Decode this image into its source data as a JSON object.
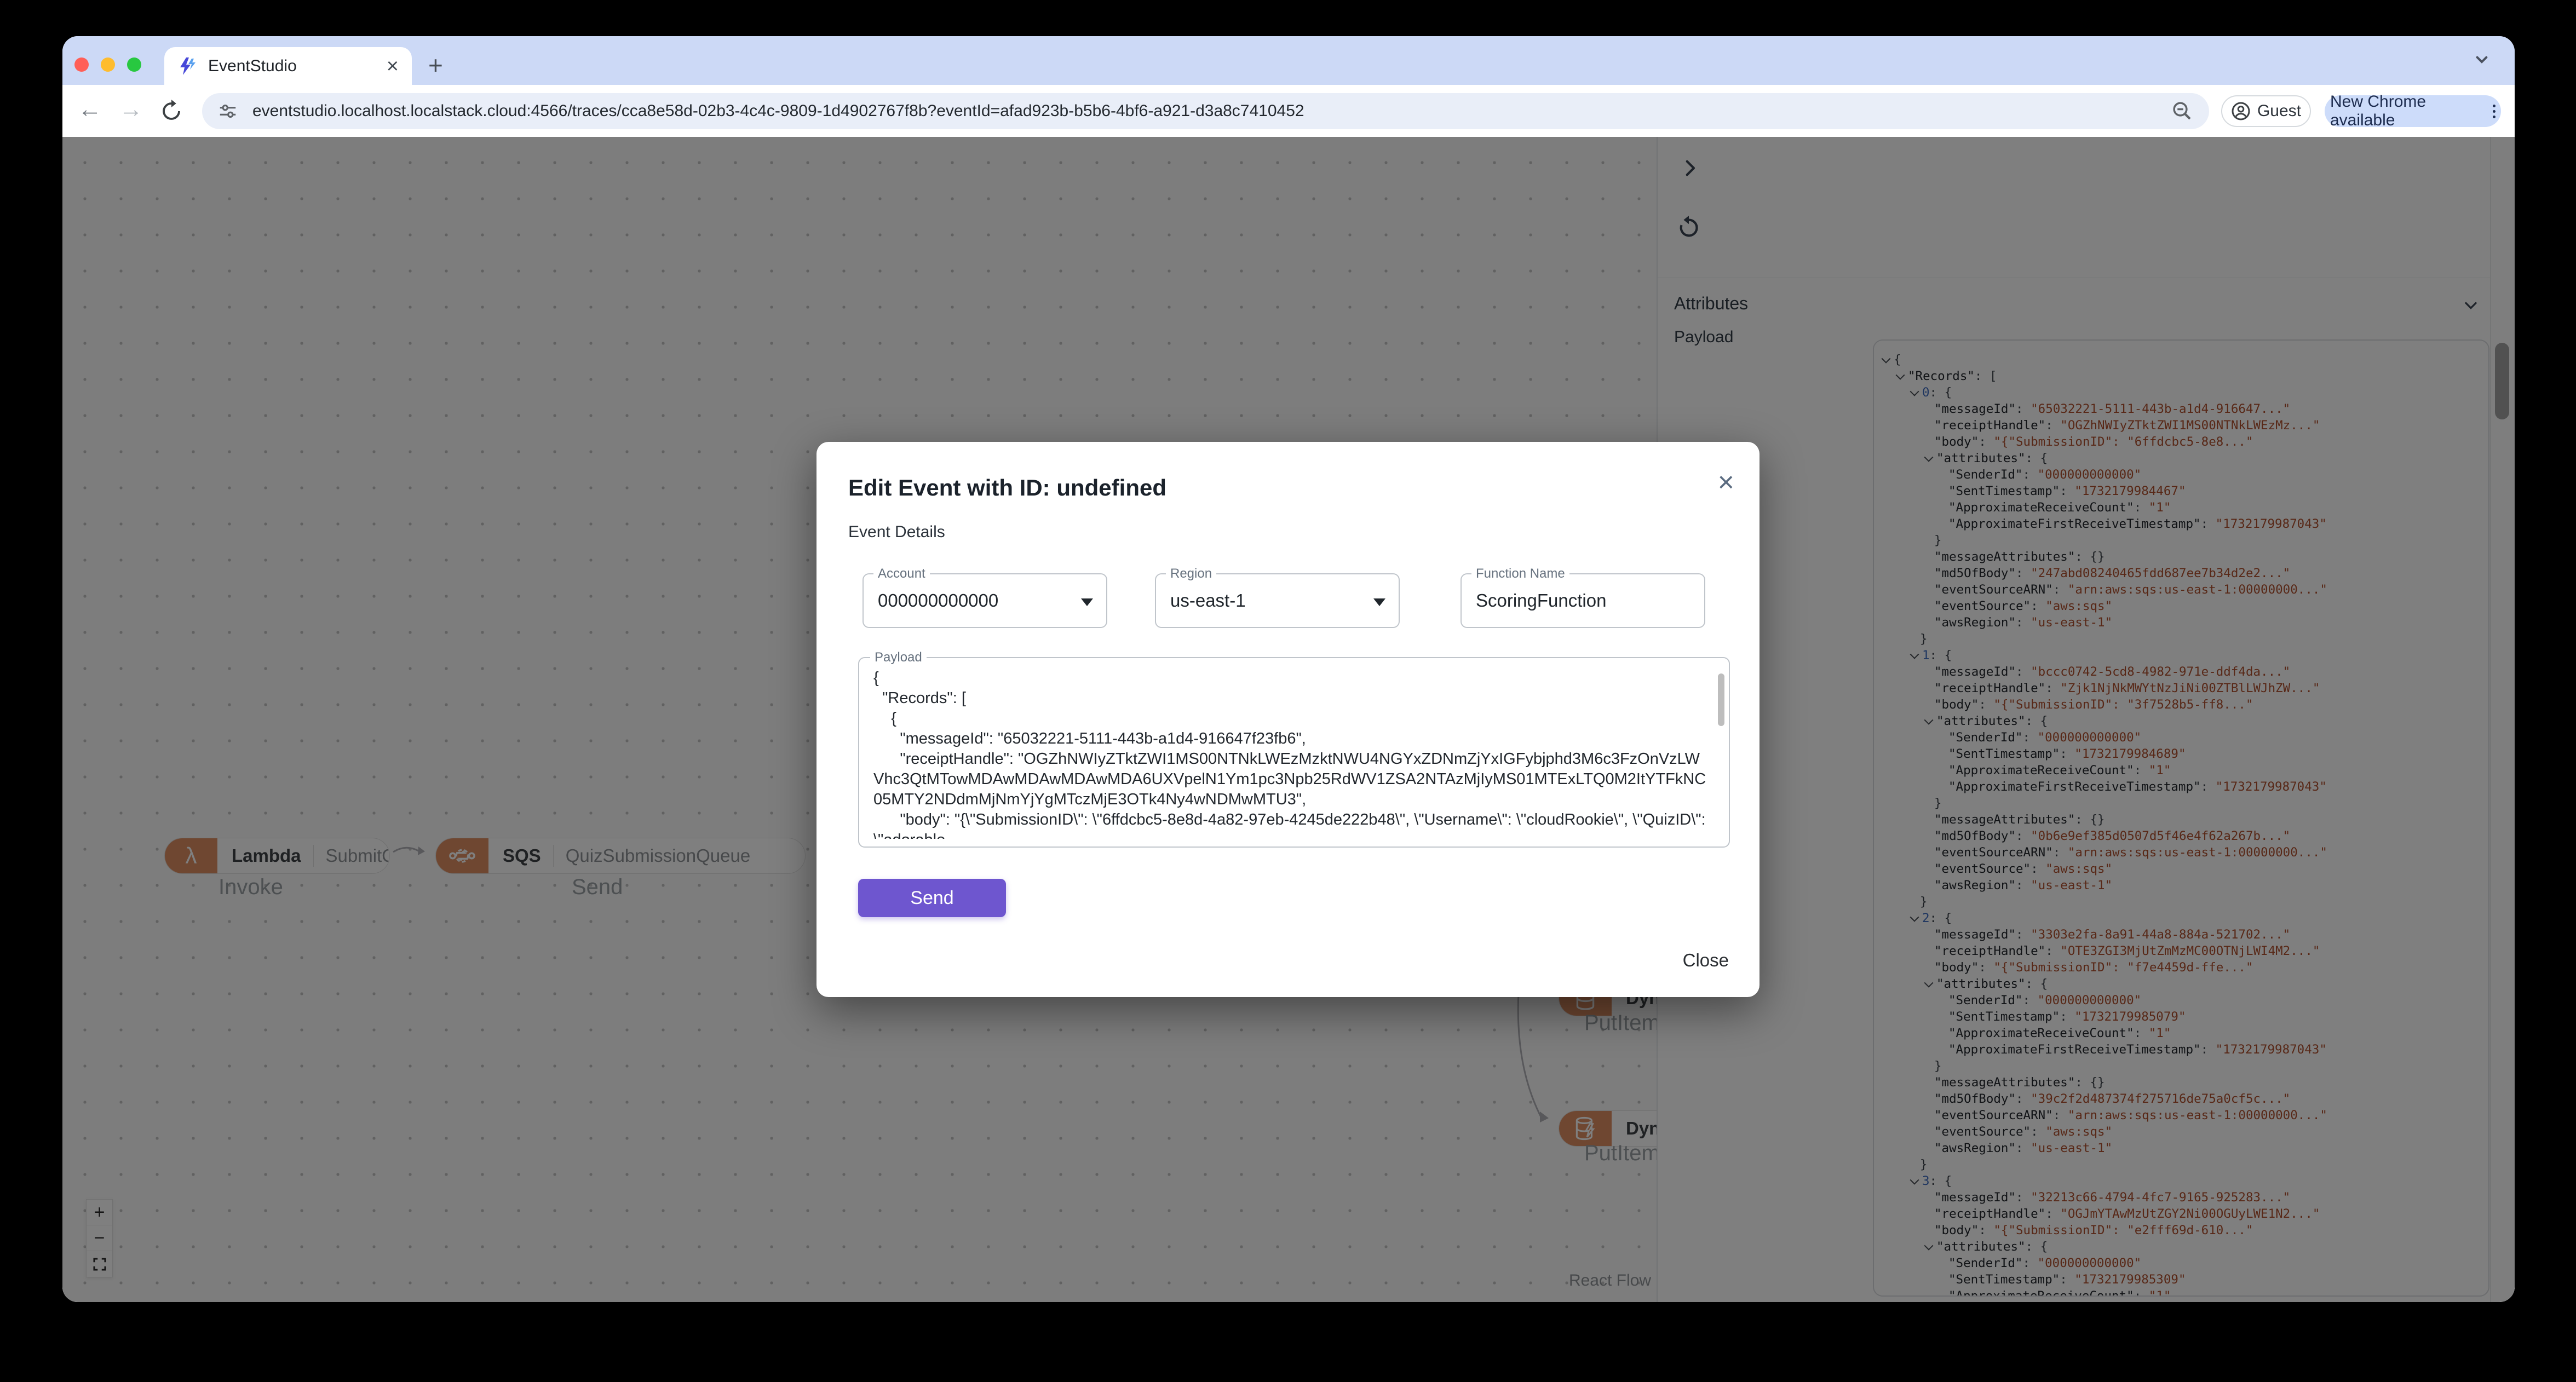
{
  "browser": {
    "tab_title": "EventStudio",
    "url": "eventstudio.localhost.localstack.cloud:4566/traces/cca8e58d-02b3-4c4c-9809-1d4902767f8b?eventId=afad923b-b5b6-4bf6-a921-d3a8c7410452",
    "profile_label": "Guest",
    "update_label": "New Chrome available"
  },
  "icons": {
    "close": "×",
    "plus": "+",
    "minus": "−",
    "back": "←",
    "forward": "→",
    "lambda_glyph": "λ"
  },
  "canvas": {
    "nodes": {
      "lambda": {
        "type": "Lambda",
        "name": "SubmitQuizFunction",
        "edge_label": "Invoke"
      },
      "sqs": {
        "type": "SQS",
        "name": "QuizSubmissionQueue",
        "edge_label": "Send"
      },
      "dynamodb_top": {
        "type": "DynamoDB",
        "edge_label": "PutItem"
      },
      "dynamodb_bottom": {
        "type": "DynamoDB",
        "edge_label": "PutItem"
      }
    },
    "attribution": "React Flow"
  },
  "panel": {
    "attributes_label": "Attributes",
    "payload_label": "Payload",
    "json_lines": [
      {
        "d": 0,
        "c": 1,
        "v": "{",
        "vt": "p"
      },
      {
        "d": 1,
        "c": 1,
        "k": "\"Records\"",
        "v": "[",
        "vt": "p"
      },
      {
        "d": 2,
        "c": 1,
        "k": "0",
        "ki": "i",
        "v": "{",
        "vt": "p"
      },
      {
        "d": 3,
        "k": "\"messageId\"",
        "v": "\"65032221-5111-443b-a1d4-916647...\"",
        "vt": "s"
      },
      {
        "d": 3,
        "k": "\"receiptHandle\"",
        "v": "\"OGZhNWIyZTktZWI1MS00NTNkLWEzMz...\"",
        "vt": "s"
      },
      {
        "d": 3,
        "k": "\"body\"",
        "v": "\"{\"SubmissionID\": \"6ffdcbc5-8e8...\"",
        "vt": "s"
      },
      {
        "d": 3,
        "c": 1,
        "k": "\"attributes\"",
        "v": "{",
        "vt": "p"
      },
      {
        "d": 4,
        "k": "\"SenderId\"",
        "v": "\"000000000000\"",
        "vt": "s"
      },
      {
        "d": 4,
        "k": "\"SentTimestamp\"",
        "v": "\"1732179984467\"",
        "vt": "s"
      },
      {
        "d": 4,
        "k": "\"ApproximateReceiveCount\"",
        "v": "\"1\"",
        "vt": "s"
      },
      {
        "d": 4,
        "k": "\"ApproximateFirstReceiveTimestamp\"",
        "v": "\"1732179987043\"",
        "vt": "s"
      },
      {
        "d": 3,
        "v": "}",
        "vt": "p"
      },
      {
        "d": 3,
        "k": "\"messageAttributes\"",
        "v": "{}",
        "vt": "p"
      },
      {
        "d": 3,
        "k": "\"md5OfBody\"",
        "v": "\"247abd08240465fdd687ee7b34d2e2...\"",
        "vt": "s"
      },
      {
        "d": 3,
        "k": "\"eventSourceARN\"",
        "v": "\"arn:aws:sqs:us-east-1:00000000...\"",
        "vt": "s"
      },
      {
        "d": 3,
        "k": "\"eventSource\"",
        "v": "\"aws:sqs\"",
        "vt": "s"
      },
      {
        "d": 3,
        "k": "\"awsRegion\"",
        "v": "\"us-east-1\"",
        "vt": "s"
      },
      {
        "d": 2,
        "v": "}",
        "vt": "p"
      },
      {
        "d": 2,
        "c": 1,
        "k": "1",
        "ki": "i",
        "v": "{",
        "vt": "p"
      },
      {
        "d": 3,
        "k": "\"messageId\"",
        "v": "\"bccc0742-5cd8-4982-971e-ddf4da...\"",
        "vt": "s"
      },
      {
        "d": 3,
        "k": "\"receiptHandle\"",
        "v": "\"Zjk1NjNkMWYtNzJiNi00ZTBlLWJhZW...\"",
        "vt": "s"
      },
      {
        "d": 3,
        "k": "\"body\"",
        "v": "\"{\"SubmissionID\": \"3f7528b5-ff8...\"",
        "vt": "s"
      },
      {
        "d": 3,
        "c": 1,
        "k": "\"attributes\"",
        "v": "{",
        "vt": "p"
      },
      {
        "d": 4,
        "k": "\"SenderId\"",
        "v": "\"000000000000\"",
        "vt": "s"
      },
      {
        "d": 4,
        "k": "\"SentTimestamp\"",
        "v": "\"1732179984689\"",
        "vt": "s"
      },
      {
        "d": 4,
        "k": "\"ApproximateReceiveCount\"",
        "v": "\"1\"",
        "vt": "s"
      },
      {
        "d": 4,
        "k": "\"ApproximateFirstReceiveTimestamp\"",
        "v": "\"1732179987043\"",
        "vt": "s"
      },
      {
        "d": 3,
        "v": "}",
        "vt": "p"
      },
      {
        "d": 3,
        "k": "\"messageAttributes\"",
        "v": "{}",
        "vt": "p"
      },
      {
        "d": 3,
        "k": "\"md5OfBody\"",
        "v": "\"0b6e9ef385d0507d5f46e4f62a267b...\"",
        "vt": "s"
      },
      {
        "d": 3,
        "k": "\"eventSourceARN\"",
        "v": "\"arn:aws:sqs:us-east-1:00000000...\"",
        "vt": "s"
      },
      {
        "d": 3,
        "k": "\"eventSource\"",
        "v": "\"aws:sqs\"",
        "vt": "s"
      },
      {
        "d": 3,
        "k": "\"awsRegion\"",
        "v": "\"us-east-1\"",
        "vt": "s"
      },
      {
        "d": 2,
        "v": "}",
        "vt": "p"
      },
      {
        "d": 2,
        "c": 1,
        "k": "2",
        "ki": "i",
        "v": "{",
        "vt": "p"
      },
      {
        "d": 3,
        "k": "\"messageId\"",
        "v": "\"3303e2fa-8a91-44a8-884a-521702...\"",
        "vt": "s"
      },
      {
        "d": 3,
        "k": "\"receiptHandle\"",
        "v": "\"OTE3ZGI3MjUtZmMzMC00OTNjLWI4M2...\"",
        "vt": "s"
      },
      {
        "d": 3,
        "k": "\"body\"",
        "v": "\"{\"SubmissionID\": \"f7e4459d-ffe...\"",
        "vt": "s"
      },
      {
        "d": 3,
        "c": 1,
        "k": "\"attributes\"",
        "v": "{",
        "vt": "p"
      },
      {
        "d": 4,
        "k": "\"SenderId\"",
        "v": "\"000000000000\"",
        "vt": "s"
      },
      {
        "d": 4,
        "k": "\"SentTimestamp\"",
        "v": "\"1732179985079\"",
        "vt": "s"
      },
      {
        "d": 4,
        "k": "\"ApproximateReceiveCount\"",
        "v": "\"1\"",
        "vt": "s"
      },
      {
        "d": 4,
        "k": "\"ApproximateFirstReceiveTimestamp\"",
        "v": "\"1732179987043\"",
        "vt": "s"
      },
      {
        "d": 3,
        "v": "}",
        "vt": "p"
      },
      {
        "d": 3,
        "k": "\"messageAttributes\"",
        "v": "{}",
        "vt": "p"
      },
      {
        "d": 3,
        "k": "\"md5OfBody\"",
        "v": "\"39c2f2d487374f275716de75a0cf5c...\"",
        "vt": "s"
      },
      {
        "d": 3,
        "k": "\"eventSourceARN\"",
        "v": "\"arn:aws:sqs:us-east-1:00000000...\"",
        "vt": "s"
      },
      {
        "d": 3,
        "k": "\"eventSource\"",
        "v": "\"aws:sqs\"",
        "vt": "s"
      },
      {
        "d": 3,
        "k": "\"awsRegion\"",
        "v": "\"us-east-1\"",
        "vt": "s"
      },
      {
        "d": 2,
        "v": "}",
        "vt": "p"
      },
      {
        "d": 2,
        "c": 1,
        "k": "3",
        "ki": "i",
        "v": "{",
        "vt": "p"
      },
      {
        "d": 3,
        "k": "\"messageId\"",
        "v": "\"32213c66-4794-4fc7-9165-925283...\"",
        "vt": "s"
      },
      {
        "d": 3,
        "k": "\"receiptHandle\"",
        "v": "\"OGJmYTAwMzUtZGY2Ni00OGUyLWE1N2...\"",
        "vt": "s"
      },
      {
        "d": 3,
        "k": "\"body\"",
        "v": "\"{\"SubmissionID\": \"e2fff69d-610...\"",
        "vt": "s"
      },
      {
        "d": 3,
        "c": 1,
        "k": "\"attributes\"",
        "v": "{",
        "vt": "p"
      },
      {
        "d": 4,
        "k": "\"SenderId\"",
        "v": "\"000000000000\"",
        "vt": "s"
      },
      {
        "d": 4,
        "k": "\"SentTimestamp\"",
        "v": "\"1732179985309\"",
        "vt": "s"
      },
      {
        "d": 4,
        "k": "\"ApproximateReceiveCount\"",
        "v": "\"1\"",
        "vt": "s"
      }
    ]
  },
  "modal": {
    "title": "Edit Event with ID: undefined",
    "subtitle": "Event Details",
    "fields": {
      "account": {
        "label": "Account",
        "value": "000000000000"
      },
      "region": {
        "label": "Region",
        "value": "us-east-1"
      },
      "function_name": {
        "label": "Function Name",
        "value": "ScoringFunction"
      }
    },
    "payload": {
      "label": "Payload",
      "value": "{\n  \"Records\": [\n    {\n      \"messageId\": \"65032221-5111-443b-a1d4-916647f23fb6\",\n      \"receiptHandle\": \"OGZhNWIyZTktZWI1MS00NTNkLWEzMzktNWU4NGYxZDNmZjYxIGFybjphd3M6c3FzOnVzLWVhc3QtMTowMDAwMDAwMDAwMDA6UXVpelN1Ym1pc3Npb25RdWV1ZSA2NTAzMjIyMS01MTExLTQ0M2ItYTFkNC05MTY2NDdmMjNmYjYgMTczMjE3OTk4Ny4wNDMwMTU3\",\n      \"body\": \"{\\\"SubmissionID\\\": \\\"6ffdcbc5-8e8d-4a82-97eb-4245de222b48\\\", \\\"Username\\\": \\\"cloudRookie\\\", \\\"QuizID\\\": \\\"adorable-"
    },
    "send_label": "Send",
    "close_label": "Close"
  },
  "colors": {
    "accent_purple": "#6e56cf",
    "aws_orange": "#de8e62",
    "tabstrip_blue": "#ccd9f6",
    "update_chip_blue": "#cddcfa",
    "json_string": "#b0502e",
    "json_index": "#3f6cc0"
  }
}
